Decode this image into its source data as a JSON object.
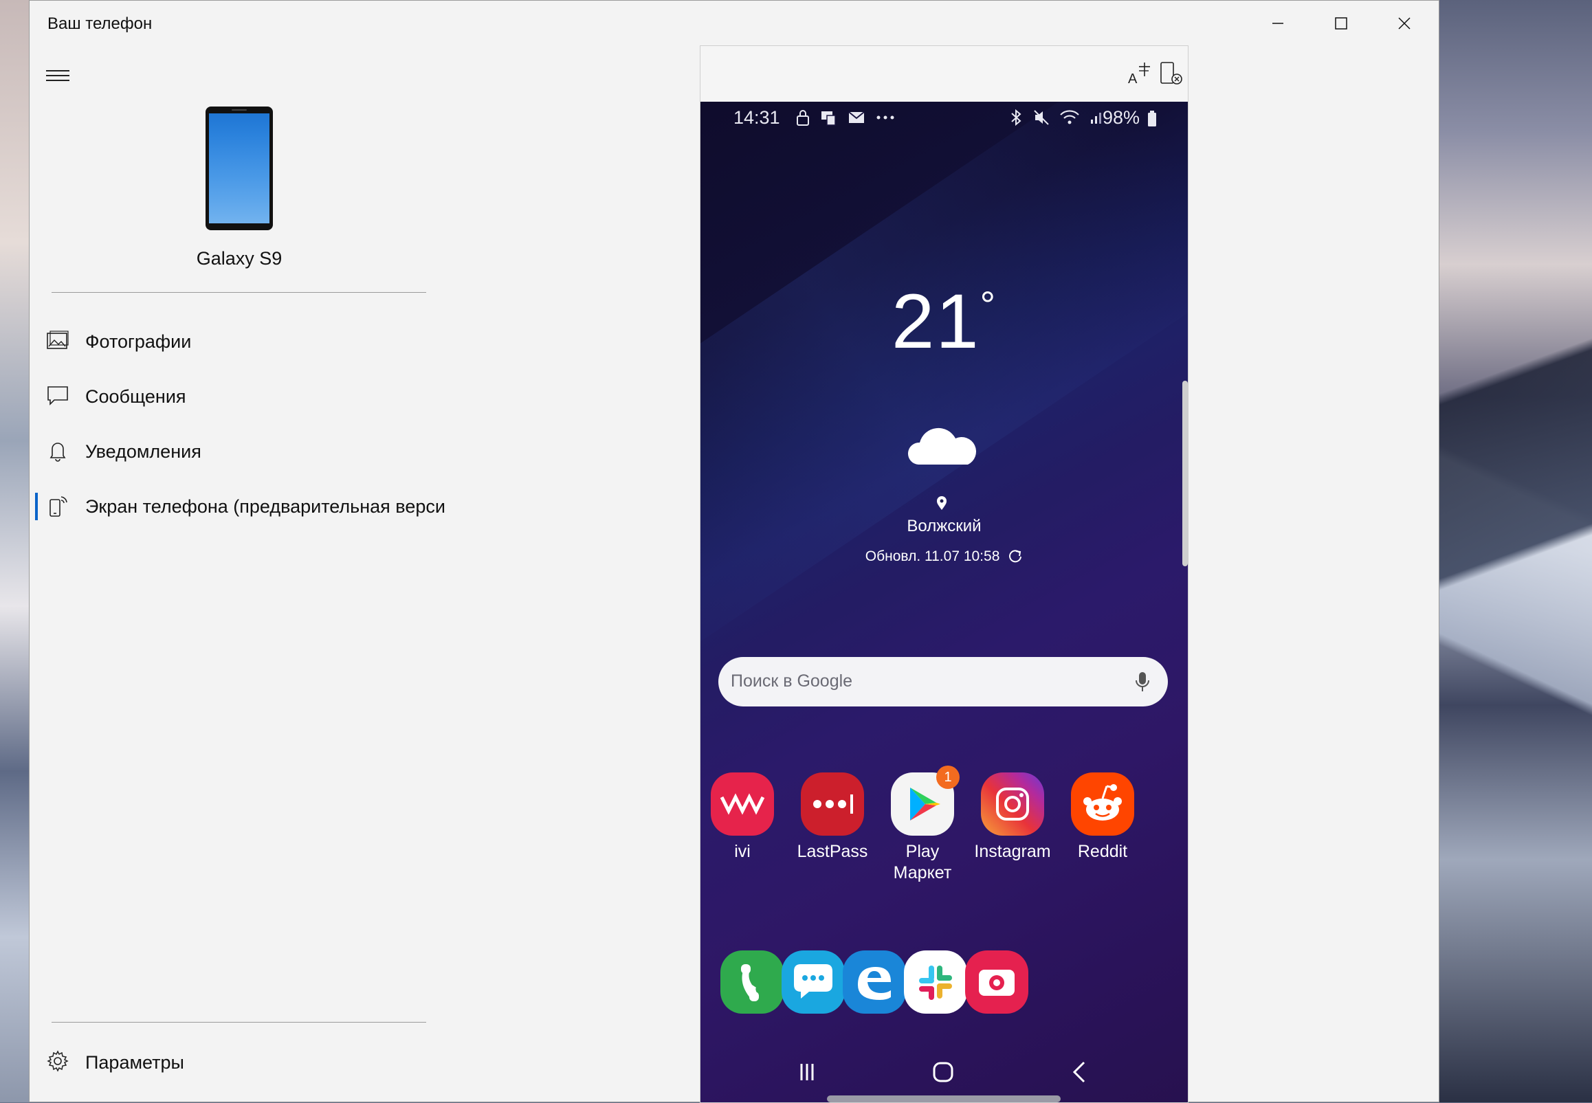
{
  "window": {
    "title": "Ваш телефон",
    "controls": [
      "minimize",
      "maximize",
      "close"
    ]
  },
  "sidebar": {
    "device_name": "Galaxy S9",
    "items": [
      {
        "label": "Фотографии",
        "icon": "photos-icon"
      },
      {
        "label": "Сообщения",
        "icon": "messages-icon"
      },
      {
        "label": "Уведомления",
        "icon": "bell-icon"
      },
      {
        "label": "Экран телефона (предварительная верси",
        "icon": "phone-screen-icon",
        "active": true
      }
    ],
    "settings_label": "Параметры"
  },
  "phone": {
    "status": {
      "time": "14:31",
      "battery": "98%"
    },
    "weather": {
      "temperature": "21",
      "degree": "°",
      "city": "Волжский",
      "updated": "Обновл. 11.07 10:58"
    },
    "search_placeholder": "Поиск в Google",
    "apps": [
      {
        "name": "ivi",
        "color": "#e6234b"
      },
      {
        "name": "LastPass",
        "color": "#cc1f2c"
      },
      {
        "name": "Play\nМаркет",
        "color": "#f4f4f4",
        "badge": "1"
      },
      {
        "name": "Instagram",
        "color": "#c3318f"
      },
      {
        "name": "Reddit",
        "color": "#ff4500"
      }
    ],
    "dock": [
      {
        "name": "phone",
        "color": "#2faa4d"
      },
      {
        "name": "messages",
        "color": "#1aa7e0"
      },
      {
        "name": "edge",
        "color": "#1a86d8"
      },
      {
        "name": "slack",
        "color": "#ffffff"
      },
      {
        "name": "camera",
        "color": "#e5214f"
      }
    ]
  },
  "colors": {
    "accent": "#0a64c9",
    "window_bg": "#f3f3f3"
  }
}
